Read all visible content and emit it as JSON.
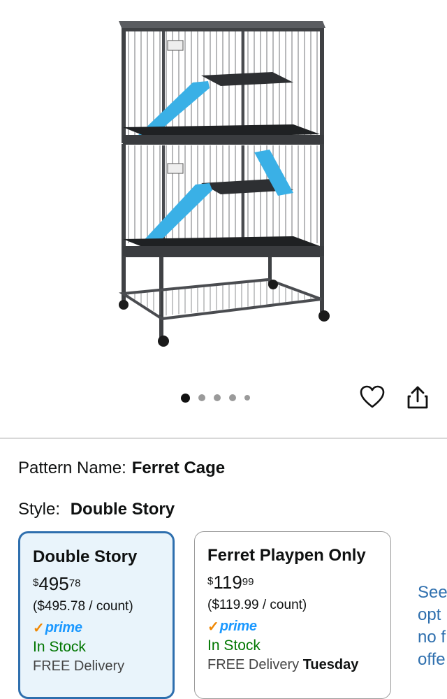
{
  "gallery": {
    "image_alt": "Ferret cage product image",
    "dots_count": 5,
    "active_index": 0
  },
  "actions": {
    "favorite_icon": "heart-icon",
    "share_icon": "share-icon"
  },
  "pattern": {
    "label": "Pattern Name:",
    "value": "Ferret Cage"
  },
  "style": {
    "label": "Style:",
    "value": "Double Story"
  },
  "options": [
    {
      "title": "Double Story",
      "currency": "$",
      "price_whole": "495",
      "price_cents": "78",
      "unit_price": "($495.78 / count)",
      "prime_label": "prime",
      "stock": "In Stock",
      "delivery": "FREE Delivery",
      "delivery_day": "",
      "selected": true
    },
    {
      "title": "Ferret Playpen Only",
      "currency": "$",
      "price_whole": "119",
      "price_cents": "99",
      "unit_price": "($119.99 / count)",
      "prime_label": "prime",
      "stock": "In Stock",
      "delivery": "FREE Delivery",
      "delivery_day": "Tuesday",
      "selected": false
    }
  ],
  "see_more": {
    "lines": [
      "See",
      "opt",
      "no f",
      "offe"
    ]
  },
  "colors": {
    "link_blue": "#2e6fae",
    "in_stock_green": "#007600",
    "prime_blue": "#1a98ff",
    "prime_orange": "#f08804",
    "cage_blue": "#3ab0e6"
  }
}
